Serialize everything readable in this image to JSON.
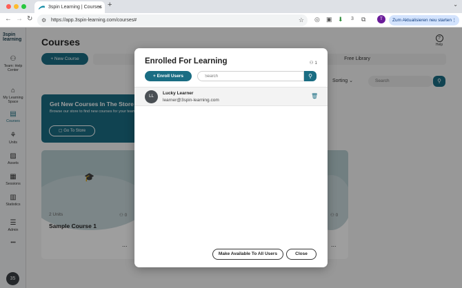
{
  "browser": {
    "tab_title": "3spin Learning | Courses",
    "tab_close": "×",
    "new_tab": "+",
    "tab_menu": "⌄",
    "url": "https://app.3spin-learning.com/courses#",
    "extension_count": "3",
    "profile_initial": "T",
    "update_button": "Zum Aktualisieren neu starten",
    "update_menu": "⋮"
  },
  "sidebar": {
    "logo_line1": "3spin",
    "logo_line2": "learning",
    "items": [
      {
        "label": "Team: Help Center"
      },
      {
        "label": "My Learning Space"
      },
      {
        "label": "Courses"
      },
      {
        "label": "Units"
      },
      {
        "label": "Assets"
      },
      {
        "label": "Sessions"
      },
      {
        "label": "Statistics"
      },
      {
        "label": "Admin"
      }
    ],
    "more": "•••",
    "avatar": "35"
  },
  "page": {
    "title": "Courses",
    "help": "Help",
    "new_course": "New Course",
    "free_library": "Free Library",
    "sorting": "Sorting",
    "search_placeholder": "Search"
  },
  "store": {
    "title": "Get New Courses In The Store",
    "text": "Browse our store to find new courses for your team!",
    "button": "Go To Store"
  },
  "cards": [
    {
      "units": "2 Units",
      "users": "0",
      "name": "Sample Course 1",
      "more": "..."
    },
    {
      "units": "",
      "users": "0",
      "name": "",
      "more": "..."
    }
  ],
  "modal": {
    "title": "Enrolled For Learning",
    "user_count": "1",
    "enroll_button": "Enroll Users",
    "search_placeholder": "Search",
    "learners": [
      {
        "initials": "LL",
        "name": "Lucky Learner",
        "email": "learner@3spin-learning.com"
      }
    ],
    "make_available": "Make Available To All Users",
    "close": "Close"
  },
  "colors": {
    "accent": "#1a6d83",
    "sidebar_bg": "#f3f4f5"
  }
}
